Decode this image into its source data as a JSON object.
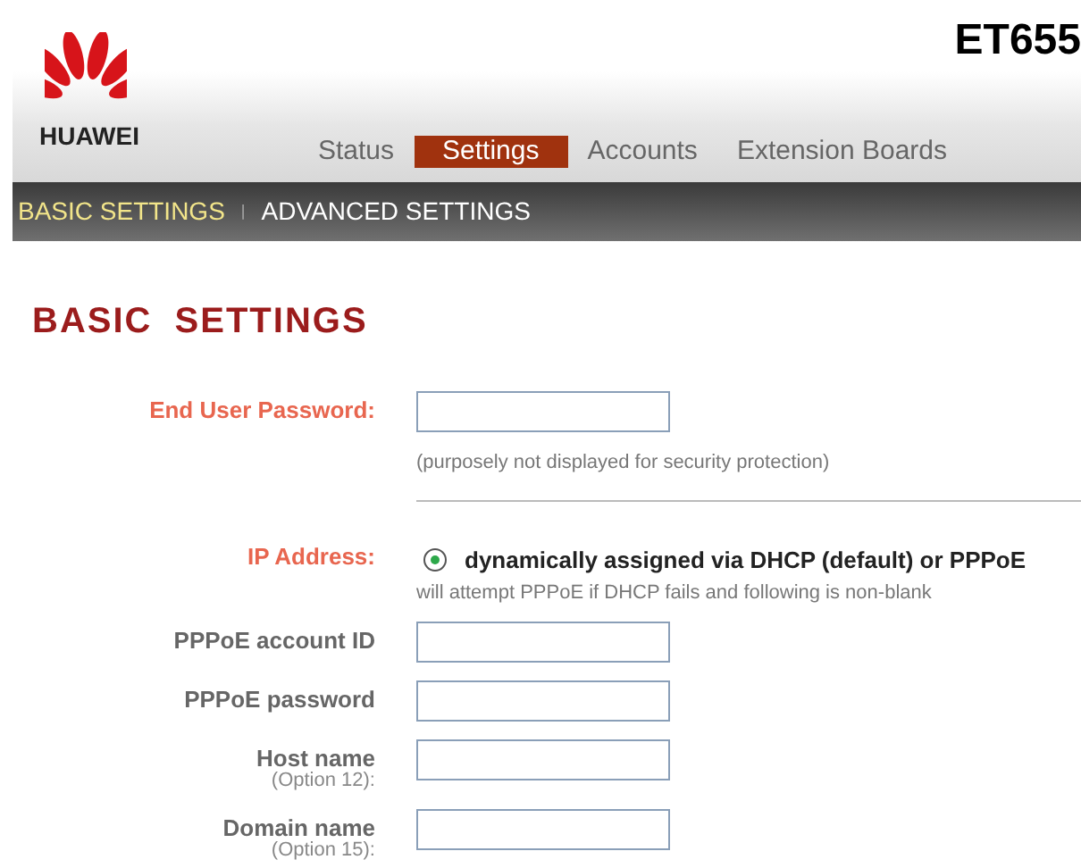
{
  "brand": {
    "logo_text": "HUAWEI",
    "model": "ET655"
  },
  "tabs": [
    {
      "label": "Status",
      "selected": false
    },
    {
      "label": "Settings",
      "selected": true
    },
    {
      "label": "Accounts",
      "selected": false
    },
    {
      "label": "Extension Boards",
      "selected": false
    }
  ],
  "subnav": [
    {
      "label": "BASIC SETTINGS",
      "selected": true
    },
    {
      "label": "ADVANCED SETTINGS",
      "selected": false
    }
  ],
  "subnav_separator": "|",
  "heading": "BASIC SETTINGS",
  "rows": [
    {
      "kind": "field",
      "label": "End User Password:",
      "highlighted": true,
      "hint": "(purposely not displayed for security protection)",
      "divider_after": true
    },
    {
      "kind": "radio",
      "label": "IP Address:",
      "highlighted": true,
      "option": "dynamically assigned via DHCP (default) or PPPoE",
      "selected": true,
      "hint": "will attempt PPPoE if DHCP fails and following is non-blank"
    },
    {
      "kind": "field",
      "label": "PPPoE account ID",
      "highlighted": false
    },
    {
      "kind": "field",
      "label": "PPPoE password",
      "highlighted": false
    },
    {
      "kind": "field",
      "label": "Host name",
      "sublabel": "(Option 12):",
      "highlighted": false
    },
    {
      "kind": "field",
      "label": "Domain name",
      "sublabel": "(Option 15):",
      "highlighted": false
    }
  ]
}
